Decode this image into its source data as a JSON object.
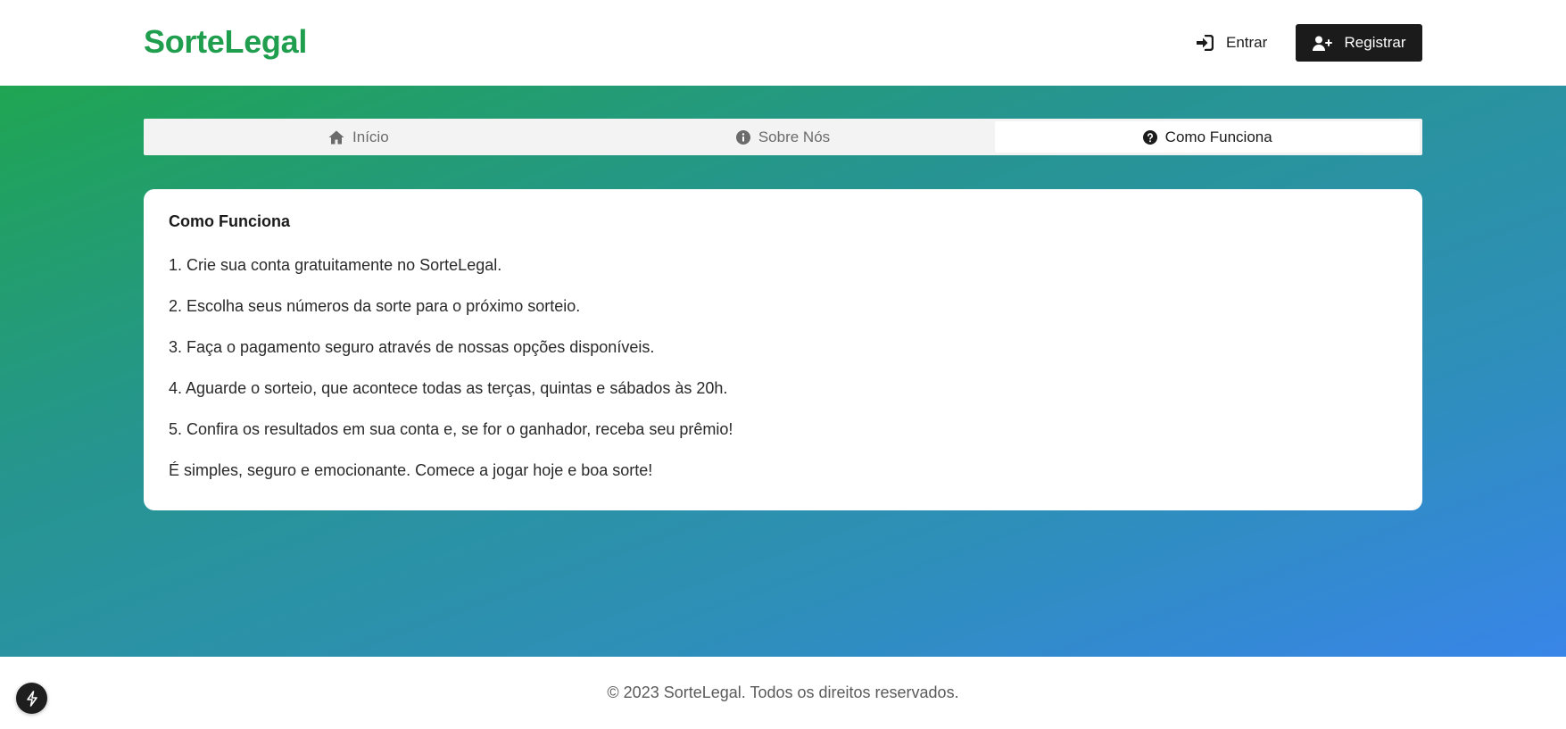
{
  "header": {
    "logo": "SorteLegal",
    "login_label": "Entrar",
    "register_label": "Registrar"
  },
  "tabs": [
    {
      "label": "Início",
      "icon": "home-icon",
      "active": false
    },
    {
      "label": "Sobre Nós",
      "icon": "info-icon",
      "active": false
    },
    {
      "label": "Como Funciona",
      "icon": "question-icon",
      "active": true
    }
  ],
  "content": {
    "title": "Como Funciona",
    "paragraphs": [
      "1. Crie sua conta gratuitamente no SorteLegal.",
      "2. Escolha seus números da sorte para o próximo sorteio.",
      "3. Faça o pagamento seguro através de nossas opções disponíveis.",
      "4. Aguarde o sorteio, que acontece todas as terças, quintas e sábados às 20h.",
      "5. Confira os resultados em sua conta e, se for o ganhador, receba seu prêmio!",
      "É simples, seguro e emocionante. Comece a jogar hoje e boa sorte!"
    ]
  },
  "footer": {
    "text": "© 2023 SorteLegal. Todos os direitos reservados."
  },
  "colors": {
    "brand": "#1f9e4e",
    "dark": "#1b1b1b",
    "gradient_start": "#1fa552",
    "gradient_end": "#3885e8"
  }
}
